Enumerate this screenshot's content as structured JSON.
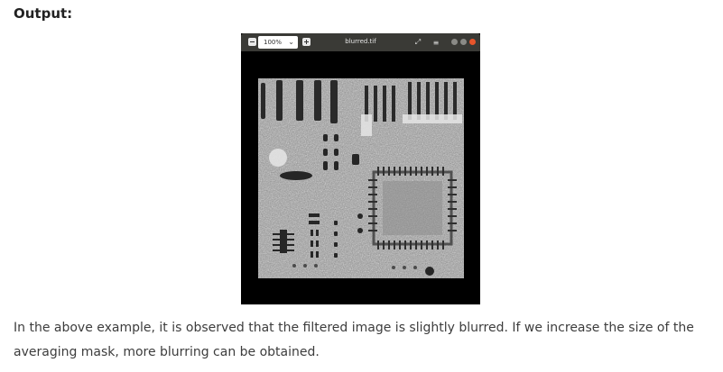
{
  "heading": "Output:",
  "viewer": {
    "zoom_value": "100%",
    "window_title": "blurred.tif"
  },
  "caption": "In the above example, it is observed that the filtered image is slightly blurred. If we increase the size of the averaging mask, more blurring can be obtained."
}
